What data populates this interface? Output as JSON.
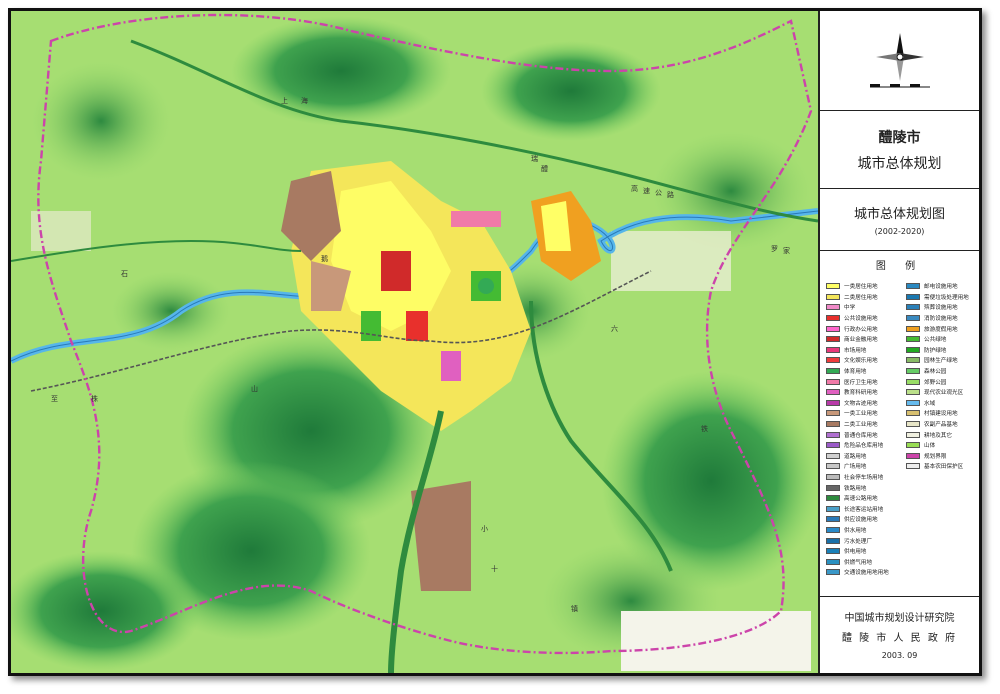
{
  "panel": {
    "title_city": "醴陵市",
    "title_plan": "城市总体规划",
    "map_title": "城市总体规划图",
    "map_years": "(2002-2020)",
    "legend_heading": "图 例",
    "org_institute": "中国城市规划设计研究院",
    "org_government": "醴 陵 市 人 民 政 府",
    "date": "2003. 09"
  },
  "legend_left": [
    {
      "label": "一类居住用地",
      "color": "#ffff66"
    },
    {
      "label": "二类居住用地",
      "color": "#f4e65a"
    },
    {
      "label": "中学",
      "color": "#f08ac8"
    },
    {
      "label": "公共设施用地",
      "color": "#e8302c"
    },
    {
      "label": "行政办公用地",
      "color": "#ff66cc"
    },
    {
      "label": "商业金融用地",
      "color": "#d02a2a"
    },
    {
      "label": "市场用地",
      "color": "#e83a7a"
    },
    {
      "label": "文化娱乐用地",
      "color": "#ee3c3c"
    },
    {
      "label": "体育用地",
      "color": "#33aa55"
    },
    {
      "label": "医疗卫生用地",
      "color": "#f07aa8"
    },
    {
      "label": "教育科研用地",
      "color": "#e060c0"
    },
    {
      "label": "文物古迹用地",
      "color": "#b83aa8"
    },
    {
      "label": "一类工业用地",
      "color": "#c8987a"
    },
    {
      "label": "二类工业用地",
      "color": "#a87a62"
    },
    {
      "label": "普通仓库用地",
      "color": "#b070d0"
    },
    {
      "label": "危险品仓库用地",
      "color": "#9b5bc8"
    },
    {
      "label": "道路用地",
      "color": "#d0d0d0"
    },
    {
      "label": "广场用地",
      "color": "#c8c8c8"
    },
    {
      "label": "社会停车场用地",
      "color": "#bbbbbb"
    },
    {
      "label": "铁路用地",
      "color": "#666666"
    },
    {
      "label": "高速公路用地",
      "color": "#2e8b3e"
    },
    {
      "label": "长途客运站用地",
      "color": "#4aa0c8"
    },
    {
      "label": "供应设施用地",
      "color": "#2a7ab8"
    },
    {
      "label": "供水用地",
      "color": "#2a8ac8"
    },
    {
      "label": "污水处理厂",
      "color": "#1a70a8"
    },
    {
      "label": "供电用地",
      "color": "#1a80b8"
    },
    {
      "label": "供燃气用地",
      "color": "#2a90c0"
    },
    {
      "label": "交通设施用地用地",
      "color": "#3a98c8"
    }
  ],
  "legend_right": [
    {
      "label": "邮电设施用地",
      "color": "#2a88c0"
    },
    {
      "label": "需便垃圾处理用地",
      "color": "#1a78b0"
    },
    {
      "label": "殡葬设施用地",
      "color": "#2a80b8"
    },
    {
      "label": "消防设施用地",
      "color": "#3a8ac0"
    },
    {
      "label": "旅游度假用地",
      "color": "#f0a020"
    },
    {
      "label": "公共绿地",
      "color": "#44bb33"
    },
    {
      "label": "防护绿地",
      "color": "#22aa22"
    },
    {
      "label": "园林生产绿地",
      "color": "#88bb66"
    },
    {
      "label": "森林公园",
      "color": "#66cc66"
    },
    {
      "label": "郊野公园",
      "color": "#99dd66"
    },
    {
      "label": "现代农业观光区",
      "color": "#bbe08a"
    },
    {
      "label": "水域",
      "color": "#66bbee"
    },
    {
      "label": "村镇建设用地",
      "color": "#d8c070"
    },
    {
      "label": "农副产品基地",
      "color": "#e8e6c8"
    },
    {
      "label": "耕地及其它",
      "color": "#f0f0e0"
    },
    {
      "label": "山体",
      "color": "#99dd55"
    },
    {
      "label": "规划界限",
      "color": "#cc44aa"
    },
    {
      "label": "基本农田保护区",
      "color": "#eeeeee"
    }
  ],
  "map_labels": [
    "上",
    "海",
    "瑞",
    "醴",
    "高",
    "速",
    "公",
    "路",
    "株",
    "六",
    "鹅",
    "小",
    "十",
    "山",
    "铁",
    "石",
    "镇",
    "罗",
    "家",
    "至"
  ]
}
